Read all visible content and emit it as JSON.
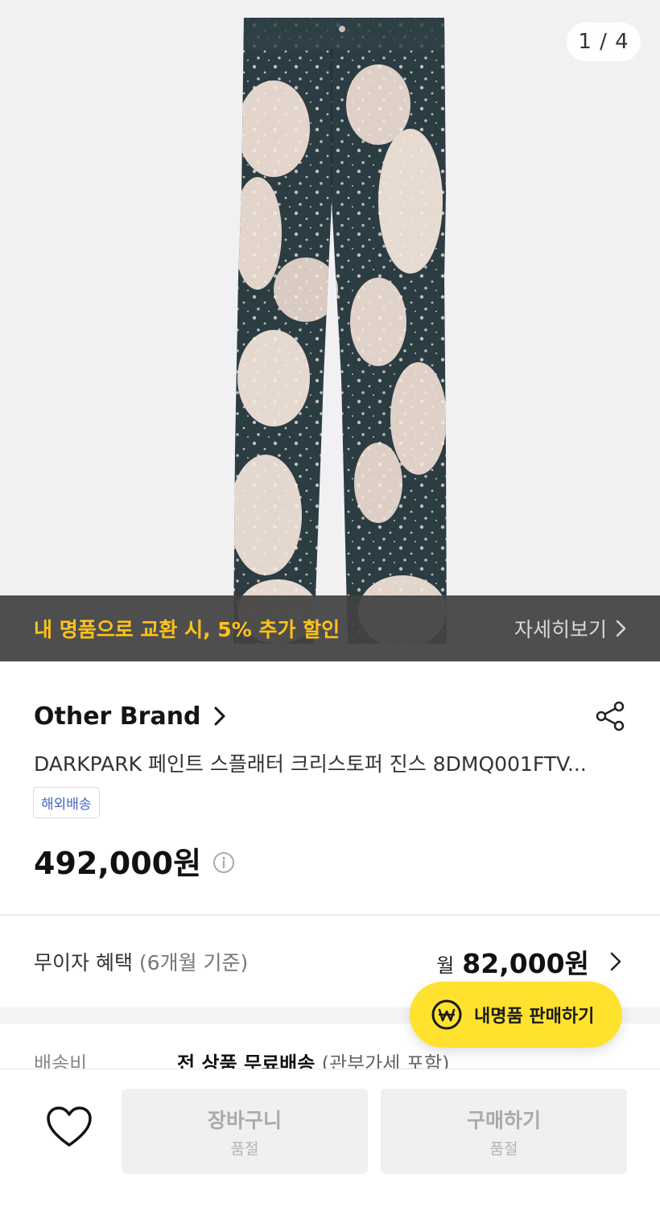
{
  "gallery": {
    "counter": "1 / 4",
    "promo_text": "내 명품으로 교환 시, 5% 추가 할인",
    "promo_more": "자세히보기"
  },
  "product": {
    "brand": "Other Brand",
    "name": "DARKPARK 페인트 스플래터 크리스토퍼 진스 8DMQ001FTV...",
    "badge": "해외배송",
    "price": "492,000원"
  },
  "installment": {
    "label": "무이자 혜택",
    "sub": "(6개월 기준)",
    "prefix": "월",
    "amount": "82,000원"
  },
  "shipping": {
    "label": "배송비",
    "value": "전 상품 무료배송",
    "sub": "(관부가세 포함)"
  },
  "fab": {
    "label": "내명품 판매하기"
  },
  "bottom_bar": {
    "cart_label": "장바구니",
    "cart_status": "품절",
    "buy_label": "구매하기",
    "buy_status": "품절"
  },
  "icons": {
    "heart": "heart-icon",
    "share": "share-icon",
    "info": "info-icon",
    "won": "won-coin-icon",
    "chevron": "chevron-right-icon"
  },
  "colors": {
    "promo_text": "#ffc21b",
    "fab_bg": "#ffe22e",
    "badge_text": "#4466c4"
  }
}
